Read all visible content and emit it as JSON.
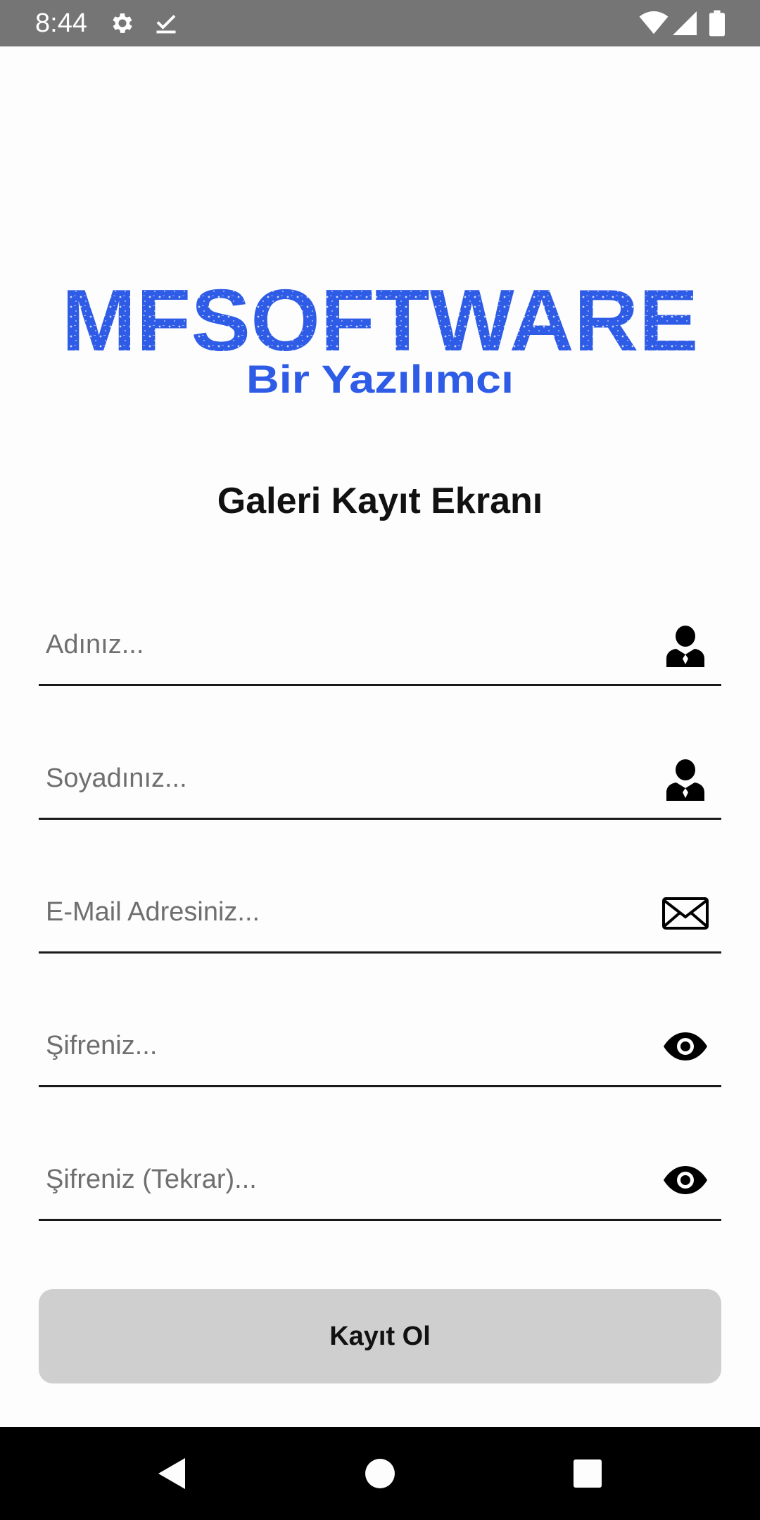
{
  "status_bar": {
    "time": "8:44",
    "icons": [
      "settings-icon",
      "download-done-icon",
      "wifi-icon",
      "signal-icon",
      "battery-icon"
    ]
  },
  "logo": {
    "brand": "MFSOFTWARE",
    "tagline": "Bir Yazılımcı",
    "color": "#2f5ce6"
  },
  "title": "Galeri Kayıt Ekranı",
  "form": {
    "first_name": {
      "placeholder": "Adınız...",
      "value": "",
      "icon": "person-icon"
    },
    "last_name": {
      "placeholder": "Soyadınız...",
      "value": "",
      "icon": "person-icon"
    },
    "email": {
      "placeholder": "E-Mail Adresiniz...",
      "value": "",
      "icon": "mail-icon"
    },
    "password": {
      "placeholder": "Şifreniz...",
      "value": "",
      "icon": "eye-icon"
    },
    "password_repeat": {
      "placeholder": "Şifreniz (Tekrar)...",
      "value": "",
      "icon": "eye-icon"
    }
  },
  "submit_label": "Kayıt Ol",
  "nav_bar": {
    "icons": [
      "back-icon",
      "home-icon",
      "recents-icon"
    ]
  }
}
